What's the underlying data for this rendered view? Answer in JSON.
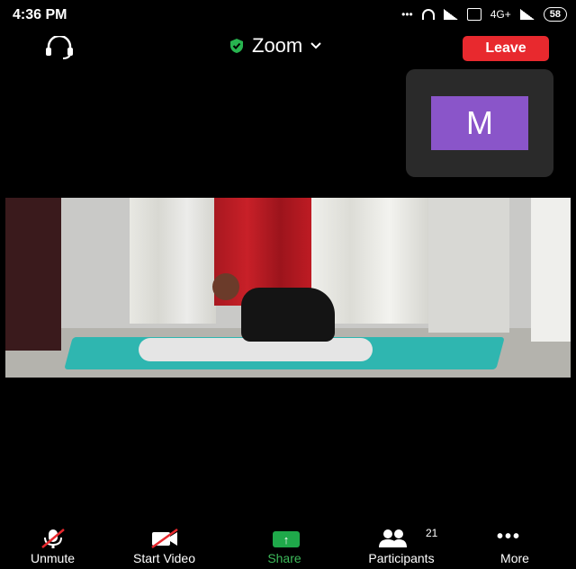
{
  "status_bar": {
    "time": "4:36 PM",
    "network_type": "4G+",
    "battery": "58"
  },
  "top_bar": {
    "meeting_title": "Zoom",
    "leave_label": "Leave",
    "icons": [
      "headset-icon",
      "shield-check-icon",
      "chevron-down-icon"
    ]
  },
  "self_view": {
    "avatar_initial": "M",
    "avatar_color": "#8a55c9"
  },
  "toolbar": {
    "unmute_label": "Unmute",
    "start_video_label": "Start Video",
    "share_label": "Share",
    "participants_label": "Participants",
    "participants_count": "21",
    "more_label": "More"
  },
  "colors": {
    "leave": "#e8292e",
    "share_green": "#1fa94a",
    "background": "#000000"
  }
}
